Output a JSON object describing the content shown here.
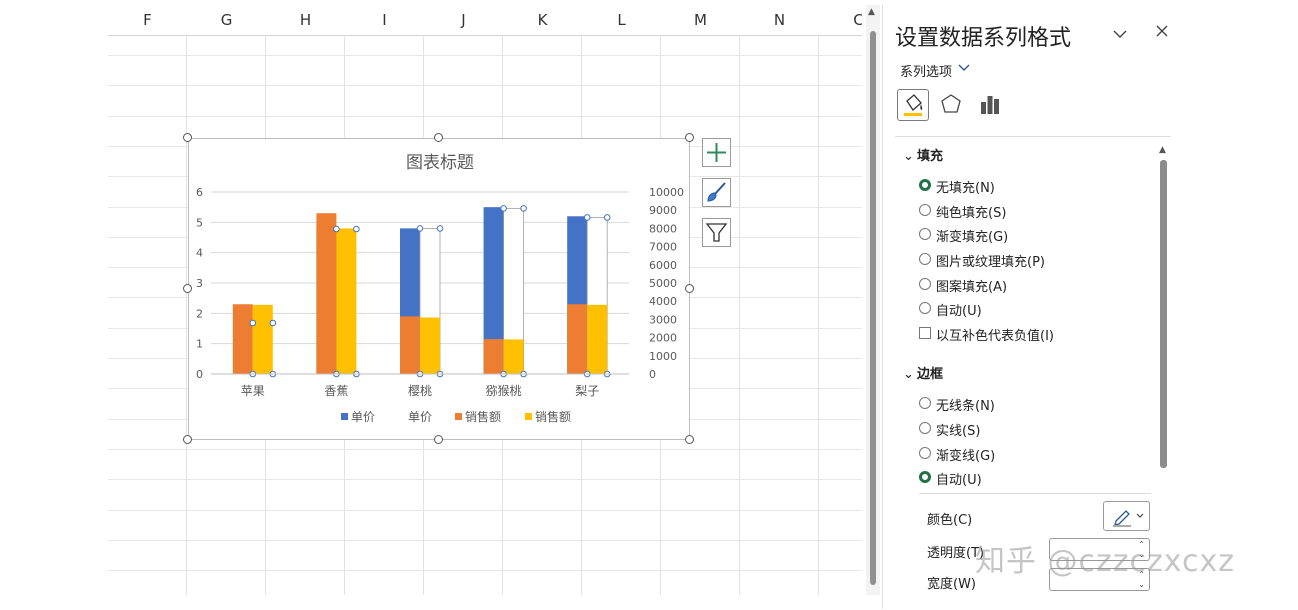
{
  "sheet": {
    "columns": [
      "F",
      "G",
      "H",
      "I",
      "J",
      "K",
      "L",
      "M",
      "N",
      "C"
    ]
  },
  "chart_tools": {
    "add_element_icon": "plus-icon",
    "style_icon": "brush-icon",
    "filter_icon": "filter-icon"
  },
  "chart_data": {
    "type": "bar",
    "title": "图表标题",
    "categories": [
      "苹果",
      "香蕉",
      "樱桃",
      "猕猴桃",
      "梨子"
    ],
    "y_left_ticks": [
      "0",
      "1",
      "2",
      "3",
      "4",
      "5",
      "6"
    ],
    "y_right_ticks": [
      "0",
      "1000",
      "2000",
      "3000",
      "4000",
      "5000",
      "6000",
      "7000",
      "8000",
      "9000",
      "10000"
    ],
    "ylim_left": [
      0,
      6
    ],
    "ylim_right": [
      0,
      10000
    ],
    "series": [
      {
        "name": "单价",
        "axis": "left",
        "color": "#4472c4",
        "values": [
          0,
          4.8,
          4.8,
          5.5,
          5.2
        ]
      },
      {
        "name": "单价",
        "axis": "right",
        "color": "none",
        "values": [
          0,
          0,
          8000,
          9100,
          8600
        ]
      },
      {
        "name": "销售额",
        "axis": "left",
        "color": "#ed7d31",
        "values": [
          2.3,
          5.3,
          1.9,
          1.15,
          2.3
        ]
      },
      {
        "name": "销售额",
        "axis": "right",
        "color": "#ffc000",
        "values": [
          3800,
          8000,
          3100,
          1900,
          3800
        ]
      }
    ],
    "legend_position": "bottom"
  },
  "pane": {
    "title": "设置数据系列格式",
    "series_options": "系列选项",
    "tabs": [
      "fill-line-icon",
      "effects-pentagon-icon",
      "series-options-bars-icon"
    ],
    "fill": {
      "header": "填充",
      "options": [
        "无填充(N)",
        "纯色填充(S)",
        "渐变填充(G)",
        "图片或纹理填充(P)",
        "图案填充(A)",
        "自动(U)"
      ],
      "selected": "无填充(N)",
      "invert": "以互补色代表负值(I)"
    },
    "border": {
      "header": "边框",
      "options": [
        "无线条(N)",
        "实线(S)",
        "渐变线(G)",
        "自动(U)"
      ],
      "selected": "自动(U)",
      "color_label": "颜色(C)",
      "transparency_label": "透明度(T)",
      "width_label": "宽度(W)"
    }
  },
  "watermark": "知乎 @czzczxcxz"
}
